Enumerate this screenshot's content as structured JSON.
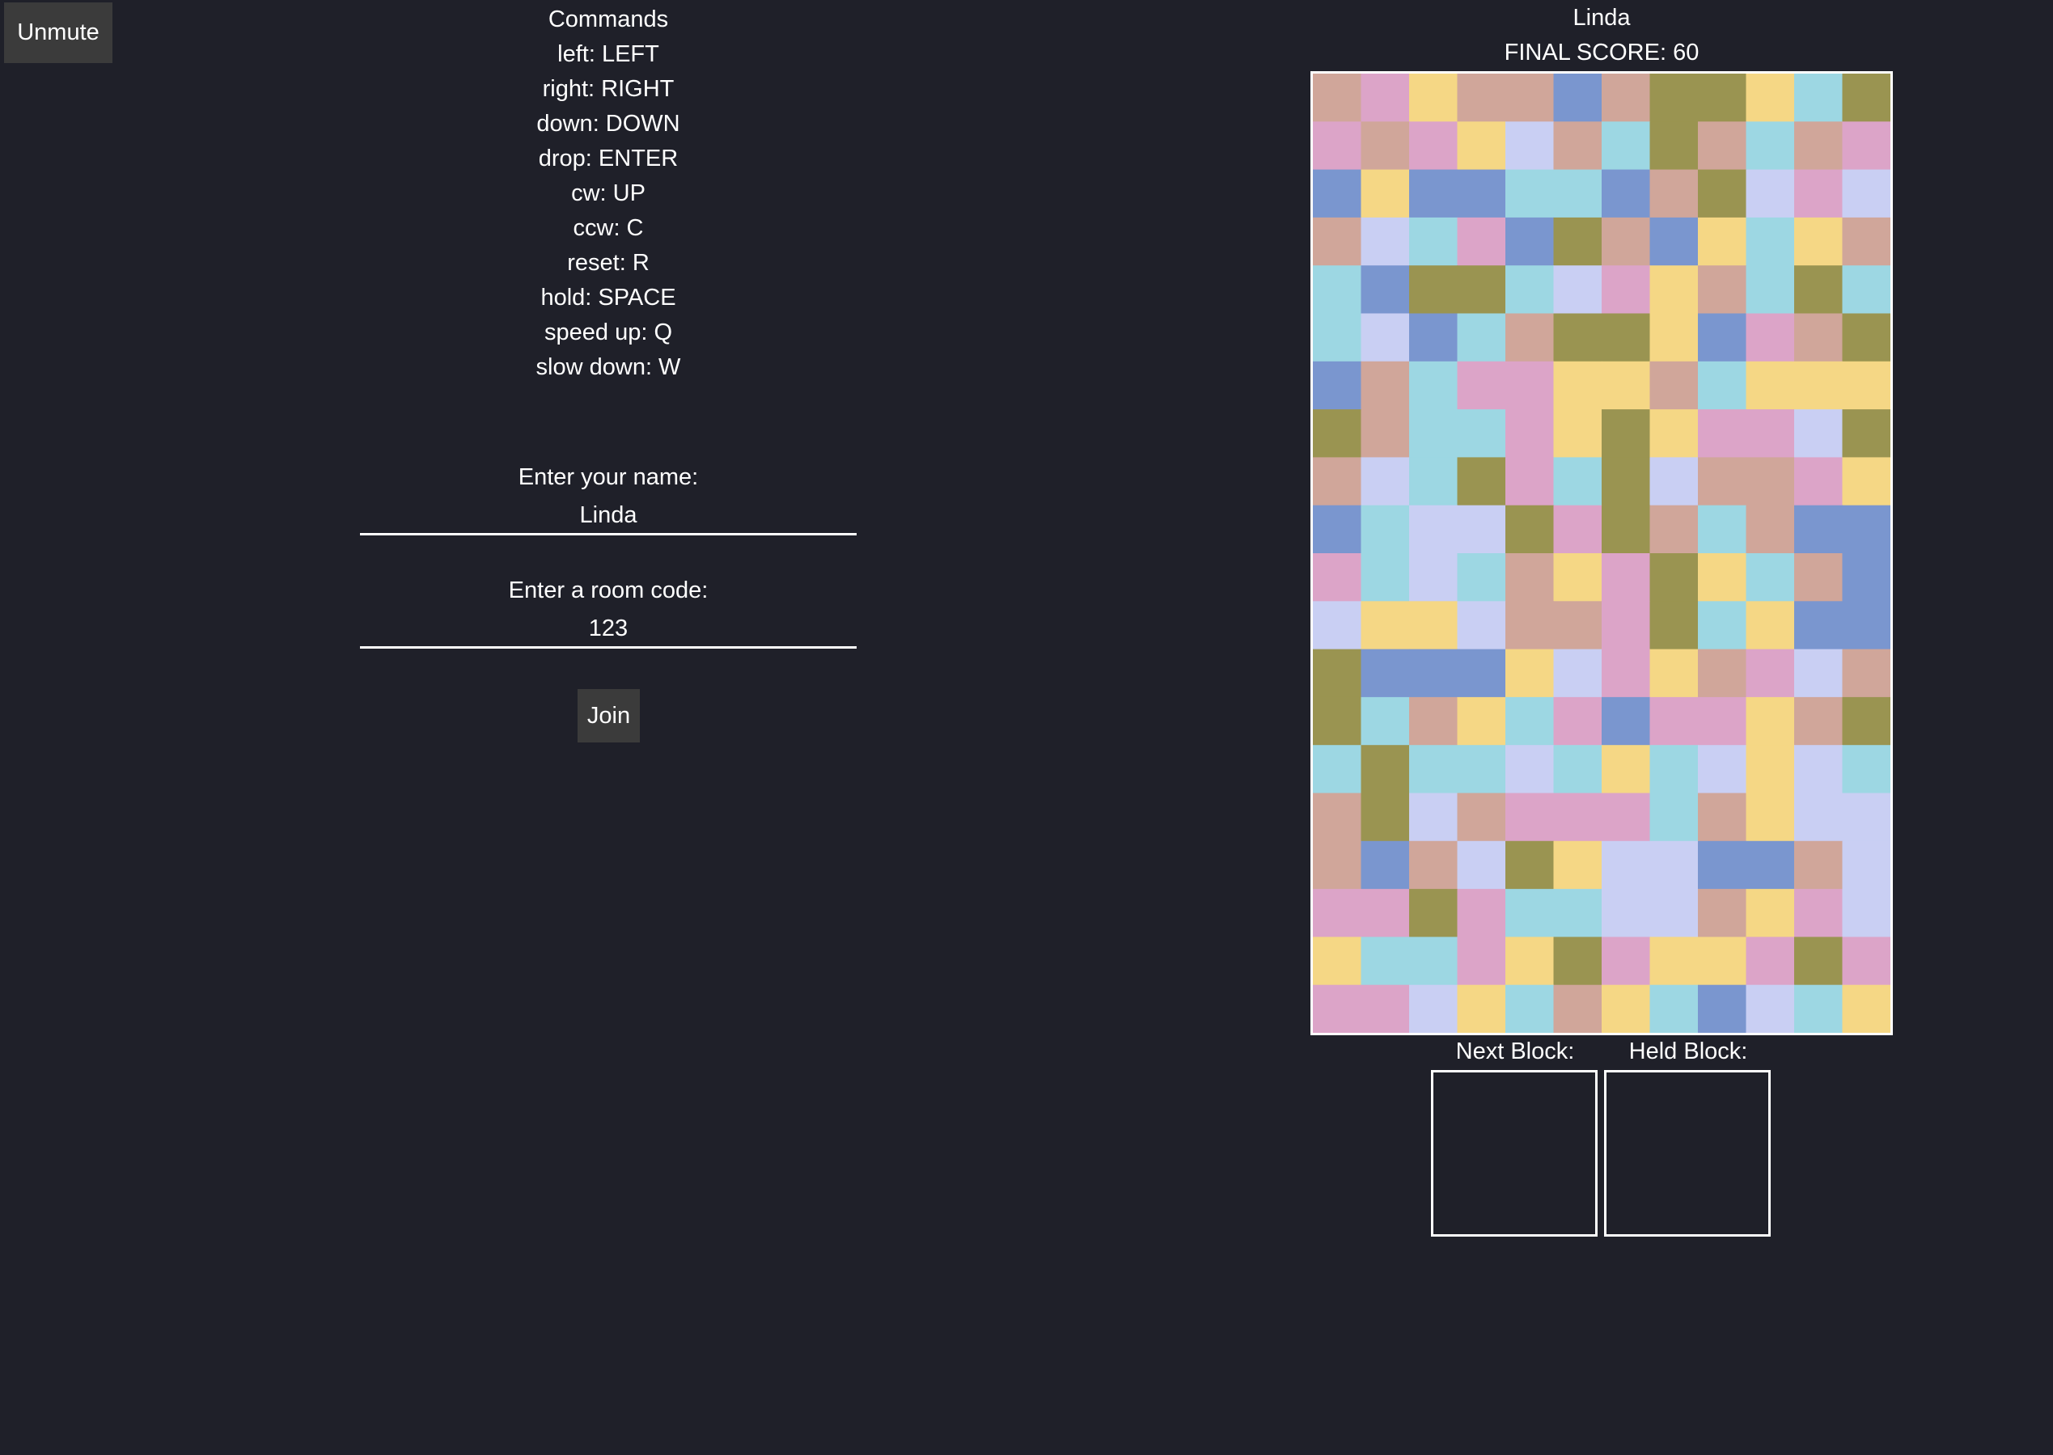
{
  "controls": {
    "unmute_label": "Unmute",
    "join_label": "Join"
  },
  "commands": {
    "title": "Commands",
    "items": [
      "left: LEFT",
      "right: RIGHT",
      "down: DOWN",
      "drop: ENTER",
      "cw: UP",
      "ccw: C",
      "reset: R",
      "hold: SPACE",
      "speed up: Q",
      "slow down: W"
    ]
  },
  "form": {
    "name_label": "Enter your name:",
    "name_value": "Linda",
    "room_label": "Enter a room code:",
    "room_value": "123"
  },
  "game": {
    "player_name": "Linda",
    "final_score": "FINAL SCORE: 60",
    "next_block_label": "Next Block:",
    "held_block_label": "Held Block:",
    "palette": {
      "A": "#d0a69a",
      "B": "#dca4c8",
      "C": "#f5d785",
      "D": "#7a96cf",
      "E": "#9a9451",
      "F": "#9dd7e3",
      "G": "#c9cff3"
    },
    "board": [
      "ABCAADAEECFE",
      "BABCGAFEAFAB",
      "DCDDFFDAEGBG",
      "AGFBDEADCFCA",
      "FDEEFGBCAFEF",
      "FGDFAEECDBAE",
      "DAFBBCCAFCCC",
      "EAFFBCECBBGE",
      "AGFEBFEGAABC",
      "DFGGEBEAFADD",
      "BFGFACBECFAD",
      "GCCGAABEFCDD",
      "EDDDCGBCABGA",
      "EFACFBDBBCAE",
      "FEFFGFCFGCGF",
      "AEGABBBFACGG",
      "ADAGECGGDDAG",
      "BBEBFFGGACBG",
      "CFFBCEBCCBEB",
      "BBGCFACFDGFC"
    ]
  }
}
